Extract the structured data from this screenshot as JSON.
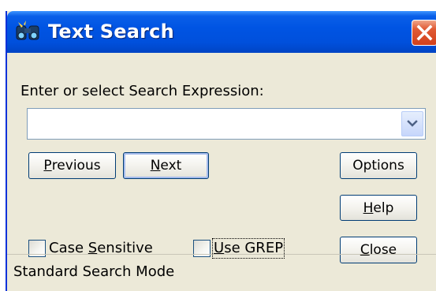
{
  "window": {
    "title": "Text Search"
  },
  "search": {
    "prompt_label": "Enter or select Search Expression:",
    "value": "",
    "placeholder": ""
  },
  "buttons": {
    "previous": {
      "pre": "",
      "mnemonic": "P",
      "post": "revious"
    },
    "next": {
      "pre": "",
      "mnemonic": "N",
      "post": "ext"
    },
    "options": {
      "pre": "",
      "mnemonic": "",
      "post": "Options"
    },
    "help": {
      "pre": "",
      "mnemonic": "H",
      "post": "elp"
    },
    "close": {
      "pre": "",
      "mnemonic": "C",
      "post": "lose"
    }
  },
  "checkboxes": {
    "case_sensitive": {
      "pre": "Case ",
      "mnemonic": "S",
      "post": "ensitive",
      "checked": false
    },
    "use_grep": {
      "pre": "",
      "mnemonic": "U",
      "post": "se GREP",
      "checked": false
    }
  },
  "status": {
    "text": "Standard Search Mode"
  },
  "icons": {
    "app": "binoculars-icon",
    "close": "close-icon",
    "dropdown": "chevron-down-icon"
  },
  "colors": {
    "titlebar": "#0054e3",
    "face": "#ece9d8",
    "close_button": "#d2401c",
    "button_border": "#003c74"
  }
}
